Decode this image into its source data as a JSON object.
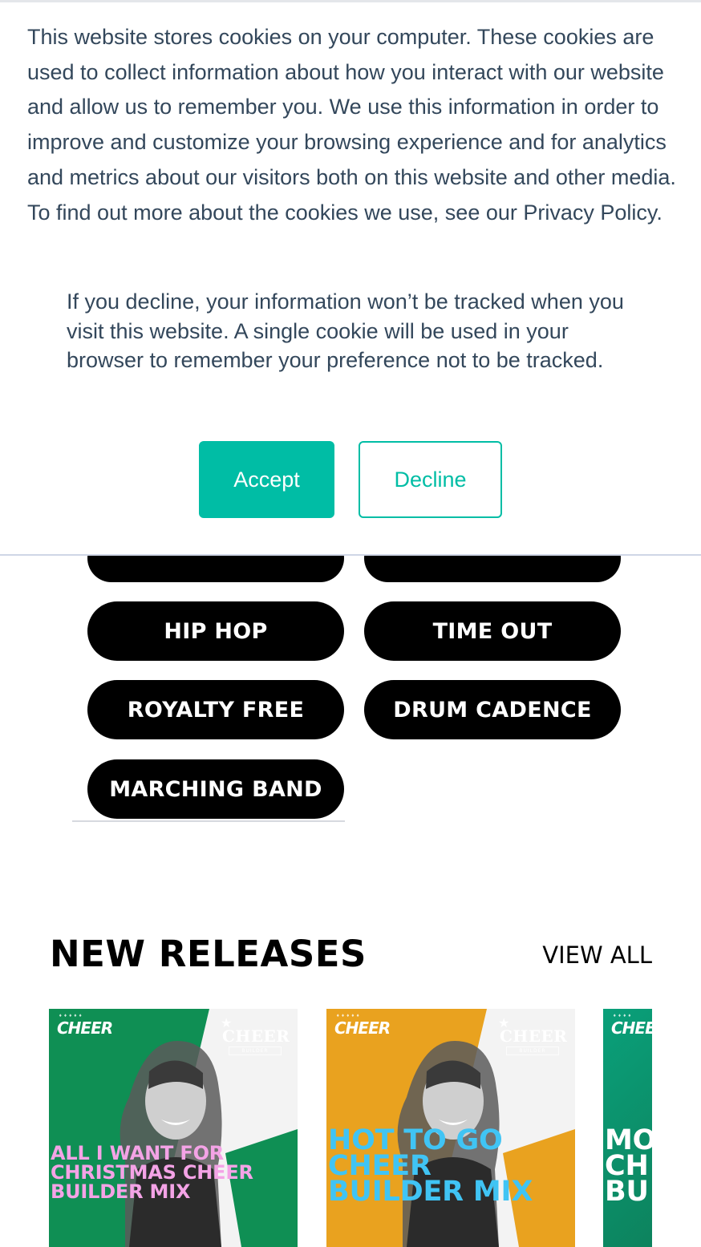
{
  "cookie_banner": {
    "main_text": "This website stores cookies on your computer. These cookies are used to collect information about how you interact with our website and allow us to remember you. We use this information in order to improve and customize your browsing experience and for analytics and metrics about our visitors both on this website and other media. To find out more about the cookies we use, see our Privacy Policy.",
    "decline_text": "If you decline, your information won’t be tracked when you visit this website. A single cookie will be used in your browser to remember your preference not to be tracked.",
    "accept_label": "Accept",
    "decline_label": "Decline",
    "colors": {
      "accent": "#00bda5",
      "text": "#33475b"
    }
  },
  "genres": {
    "items": [
      {
        "label": ""
      },
      {
        "label": ""
      },
      {
        "label": "HIP HOP"
      },
      {
        "label": "TIME OUT"
      },
      {
        "label": "ROYALTY FREE"
      },
      {
        "label": "DRUM CADENCE"
      },
      {
        "label": "MARCHING BAND"
      }
    ]
  },
  "new_releases": {
    "title": "NEW RELEASES",
    "view_all_label": "VIEW ALL",
    "cards": [
      {
        "title": "ALL I WANT FOR CHRISTMAS CHEER BUILDER MIX",
        "brand_small": "CHEER",
        "brand_logo": "CHEER",
        "brand_logo_sub": "BUILDER",
        "colors": {
          "primary": "#0f8f54",
          "secondary": "#f3f3f3",
          "title": "#f4a3e6"
        }
      },
      {
        "title": "HOT TO GO CHEER BUILDER MIX",
        "brand_small": "CHEER",
        "brand_logo": "CHEER",
        "brand_logo_sub": "BUILDER",
        "colors": {
          "primary": "#e9a21f",
          "secondary": "#f3f3f3",
          "title": "#40c4f4"
        }
      },
      {
        "title": "MO CH BU",
        "brand_small": "CHEE",
        "brand_logo": "",
        "brand_logo_sub": "",
        "colors": {
          "primary": "#0aa07a",
          "secondary": "#0f8f54",
          "title": "#ffffff"
        }
      }
    ]
  }
}
